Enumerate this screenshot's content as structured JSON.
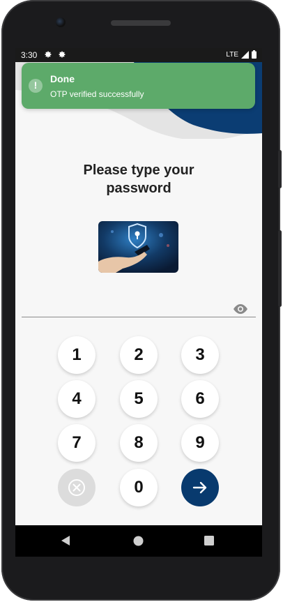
{
  "status_bar": {
    "time": "3:30",
    "network": "LTE",
    "icons": [
      "gear-icon",
      "gear-icon",
      "signal-icon",
      "battery-icon"
    ]
  },
  "toast": {
    "title": "Done",
    "message": "OTP verified successfully",
    "icon": "alert-circle-icon",
    "color": "#5daa6a"
  },
  "screen": {
    "title_line1": "Please type your",
    "title_line2": "password",
    "hero_image": "security-shield-hand-illustration",
    "password_toggle_icon": "eye-icon"
  },
  "keypad": {
    "keys": [
      "1",
      "2",
      "3",
      "4",
      "5",
      "6",
      "7",
      "8",
      "9",
      "0"
    ],
    "clear_icon": "clear-circle-icon",
    "submit_icon": "arrow-right-icon",
    "submit_color": "#083a6e"
  },
  "nav_bar": {
    "icons": [
      "back-triangle-icon",
      "home-circle-icon",
      "recents-square-icon"
    ]
  },
  "colors": {
    "brand_navy": "#0b3d73",
    "background": "#f7f7f7"
  }
}
